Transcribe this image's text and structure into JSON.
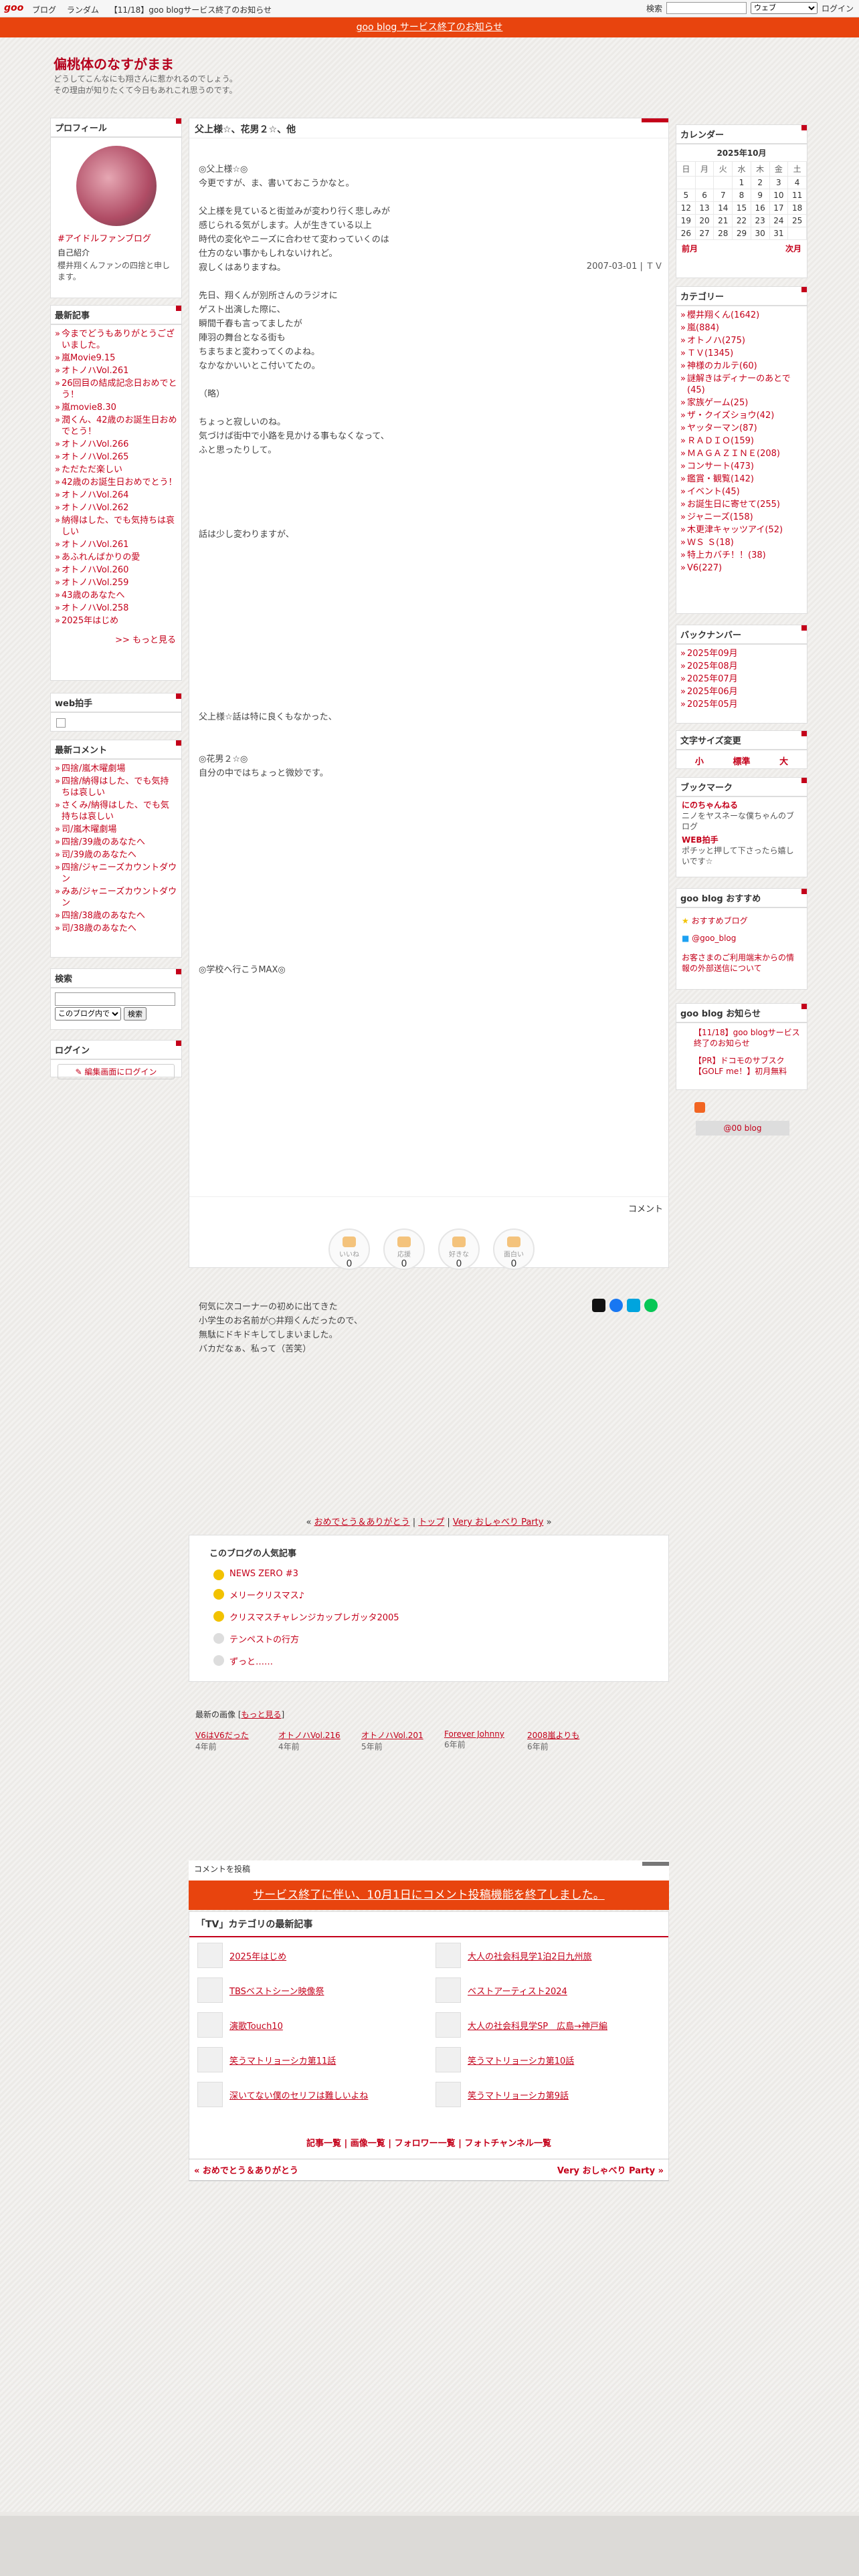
{
  "gbar": {
    "logo": "goo",
    "nav": [
      "ブログ",
      "ランダム",
      "【11/18】goo blogサービス終了のお知らせ"
    ],
    "search_label": "検索",
    "search_scope": "ウェブ",
    "login": "ログイン"
  },
  "notice": "goo blog サービス終了のお知らせ",
  "blog": {
    "title": "偏桃体のなすがまま",
    "desc": "どうしてこんなにも翔さんに惹かれるのでしょう。\nその理由が知りたくて今日もあれこれ思うのです。"
  },
  "profile": {
    "title": "プロフィール",
    "name": "#アイドルファンブログ",
    "sub": "自己紹介",
    "text": "櫻井翔くんファンの四捨と申します。"
  },
  "recent": {
    "title": "最新記事",
    "items": [
      "今までどうもありがとうございました。",
      "嵐Movie9.15",
      "オトノハVol.261",
      "26回目の結成記念日おめでとう！",
      "嵐movie8.30",
      "潤くん、42歳のお誕生日おめでとう！",
      "オトノハVol.266",
      "オトノハVol.265",
      "ただただ楽しい",
      "42歳のお誕生日おめでとう！",
      "オトノハVol.264",
      "オトノハVol.262",
      "納得はした、でも気持ちは哀しい",
      "オトノハVol.261",
      "あふれんばかりの愛",
      "オトノハVol.260",
      "オトノハVol.259",
      "43歳のあなたへ",
      "オトノハVol.258",
      "2025年はじめ"
    ],
    "more": ">> もっと見る"
  },
  "webclap": {
    "title": "web拍手"
  },
  "comments": {
    "title": "最新コメント",
    "items": [
      "四捨/嵐木曜劇場",
      "四捨/納得はした、でも気持ちは哀しい",
      "さくみ/納得はした、でも気持ちは哀しい",
      "司/嵐木曜劇場",
      "四捨/39歳のあなたへ",
      "司/39歳のあなたへ",
      "四捨/ジャニーズカウントダウン",
      "みあ/ジャニーズカウントダウン",
      "四捨/38歳のあなたへ",
      "司/38歳のあなたへ"
    ]
  },
  "search": {
    "title": "検索",
    "scope": "このブログ内で",
    "button": "検索"
  },
  "login": {
    "title": "ログイン",
    "link": "編集画面にログイン"
  },
  "post": {
    "title": "父上様☆、花男２☆、他",
    "date": "2007-03-01 | ＴＶ",
    "body": "◎父上様☆◎\n今更ですが、ま、書いておこうかなと。\n\n父上様を見ていると街並みが変わり行く悲しみが\n感じられる気がします。人が生きている以上\n時代の変化やニーズに合わせて変わっていくのは\n仕方のない事かもしれないけれど。\n寂しくはありますね。\n\n先日、翔くんが別所さんのラジオに\nゲスト出演した際に、\n瞬間千春も言ってましたが\n陣羽の舞台となる街も\nちまちまと変わってくのよね。\nなかなかいいとこ付いてたの。\n\n（略）\n\nちょっと寂しいのね。\n気づけば街中で小路を見かける事もなくなって、\nふと思ったりして。\n\n\n\n\n\n話は少し変わりますが、\n\n\n\n\n\n\n\n\n\n\n\n\n父上様☆話は特に良くもなかった、\n\n\n◎花男２☆◎\n自分の中ではちょっと微妙です。\n\n\n\n\n\n\n\n\n\n\n\n\n\n◎学校へ行こうMAX◎\n\n\n\n\n\n\n\n\n\n\n\n\n\n\n\n\n\n\n\n\n\n\n\n何気に次コーナーの初めに出てきた\n小学生のお名前が○井翔くんだったので、\n無駄にドキドキしてしまいました。\nバカだなぁ、私って（苦笑）",
    "comment_label": "コメント"
  },
  "stamps": [
    {
      "label": "いいね",
      "n": "0"
    },
    {
      "label": "応援",
      "n": "0"
    },
    {
      "label": "好きな",
      "n": "0"
    },
    {
      "label": "面白い",
      "n": "0"
    }
  ],
  "pager": {
    "prev": "おめでとう＆ありがとう",
    "top": "トップ",
    "next": "Very おしゃべり Party"
  },
  "popular": {
    "title": "このブログの人気記事",
    "items": [
      "NEWS ZERO #3",
      "メリークリスマス♪",
      "クリスマスチャレンジカップレガッタ2005",
      "テンペストの行方",
      "ずっと……"
    ]
  },
  "images": {
    "title": "最新の画像",
    "more": "もっと見る",
    "items": [
      {
        "cap": "V6はV6だった",
        "ago": "4年前"
      },
      {
        "cap": "オトノハVol.216",
        "ago": "4年前"
      },
      {
        "cap": "オトノハVol.201",
        "ago": "5年前"
      },
      {
        "cap": "Forever Johnny",
        "ago": "6年前"
      },
      {
        "cap": "2008嵐よりも",
        "ago": "6年前"
      }
    ]
  },
  "comment_post": {
    "title": "コメントを投稿",
    "bar": "サービス終了に伴い、10月1日にコメント投稿機能を終了しました。"
  },
  "tv": {
    "title": "「TV」カテゴリの最新記事",
    "items": [
      "2025年はじめ",
      "大人の社会科見学1泊2日九州旅",
      "TBSベストシーン映像祭",
      "ベストアーティスト2024",
      "演歌Touch10",
      "大人の社会科見学SP　広島→神戸編",
      "笑うマトリョーシカ第11話",
      "笑うマトリョーシカ第10話",
      "深いてない僕のセリフは難しいよね",
      "笑うマトリョーシカ第9話"
    ]
  },
  "bottom": {
    "links": "記事一覧 | 画像一覧 | フォロワー一覧 | フォトチャンネル一覧",
    "prev": "« おめでとう＆ありがとう",
    "next": "Very おしゃべり Party »"
  },
  "calendar": {
    "title": "カレンダー",
    "month": "2025年10月",
    "days": [
      "日",
      "月",
      "火",
      "水",
      "木",
      "金",
      "土"
    ],
    "weeks": [
      [
        "",
        "",
        "",
        "1",
        "2",
        "3",
        "4"
      ],
      [
        "5",
        "6",
        "7",
        "8",
        "9",
        "10",
        "11"
      ],
      [
        "12",
        "13",
        "14",
        "15",
        "16",
        "17",
        "18"
      ],
      [
        "19",
        "20",
        "21",
        "22",
        "23",
        "24",
        "25"
      ],
      [
        "26",
        "27",
        "28",
        "29",
        "30",
        "31",
        ""
      ]
    ],
    "prev": "前月",
    "next": "次月"
  },
  "categories": {
    "title": "カテゴリー",
    "items": [
      "櫻井翔くん(1642)",
      "嵐(884)",
      "オトノハ(275)",
      "ＴＶ(1345)",
      "神様のカルテ(60)",
      "謎解きはディナーのあとで(45)",
      "家族ゲーム(25)",
      "ザ・クイズショウ(42)",
      "ヤッターマン(87)",
      "ＲＡＤＩＯ(159)",
      "ＭＡＧＡＺＩＮＥ(208)",
      "コンサート(473)",
      "鑑賞・観覧(142)",
      "イベント(45)",
      "お誕生日に寄せて(255)",
      "ジャニーズ(158)",
      "木更津キャッツアイ(52)",
      "ＷＳ Ｓ(18)",
      "特上カバチ！！(38)",
      "V6(227)"
    ]
  },
  "backnumber": {
    "title": "バックナンバー",
    "items": [
      "2025年09月",
      "2025年08月",
      "2025年07月",
      "2025年06月",
      "2025年05月"
    ]
  },
  "fontsize": {
    "title": "文字サイズ変更",
    "items": [
      "小",
      "標準",
      "大"
    ]
  },
  "bookmark": {
    "title": "ブックマーク",
    "items": [
      {
        "name": "にのちゃんねる",
        "desc": "ニノをヤスネーな僕ちゃんのブログ"
      },
      {
        "name": "WEB拍手",
        "desc": "ポチッと押して下さったら嬉しいです☆"
      }
    ]
  },
  "goo": {
    "title": "goo blog おすすめ",
    "items": [
      "おすすめブログ",
      "@goo_blog"
    ],
    "note": "お客さまのご利用端末からの情報の外部送信について"
  },
  "goonotice": {
    "title": "goo blog お知らせ",
    "items": [
      "【11/18】goo blogサービス終了のお知らせ",
      "【PR】ドコモのサブスク【GOLF me！】初月無料"
    ],
    "badge": "@00 blog"
  }
}
